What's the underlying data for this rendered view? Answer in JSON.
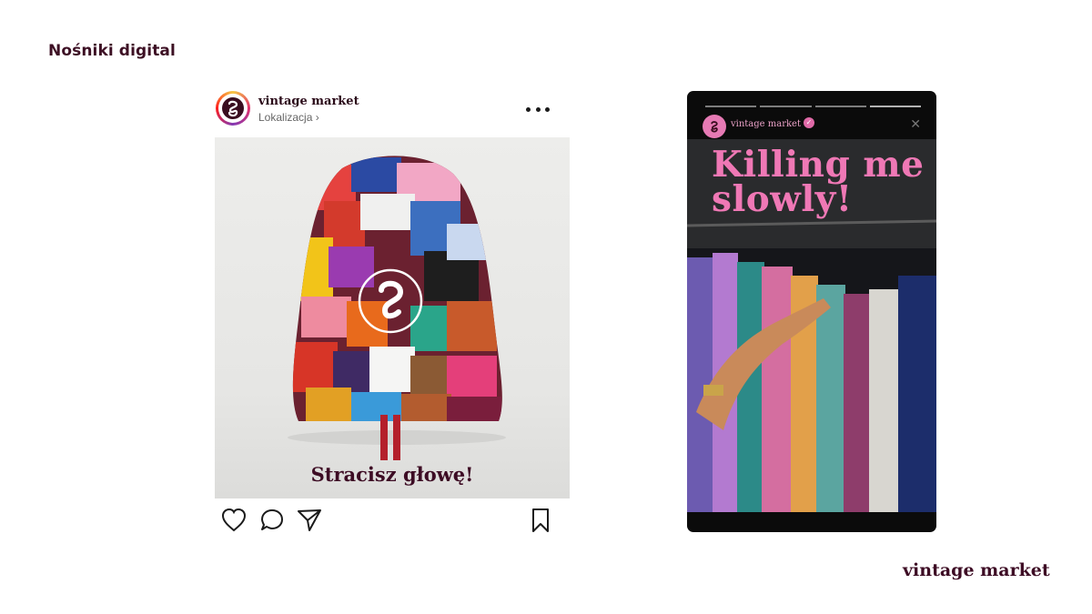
{
  "page": {
    "heading": "Nośniki digital",
    "brand_footer": "vintage market"
  },
  "post": {
    "username": "vintage market",
    "location": "Lokalizacja ›",
    "caption": "Stracisz głowę!",
    "actions": [
      "heart-icon",
      "comment-icon",
      "share-icon",
      "bookmark-icon"
    ]
  },
  "story": {
    "username": "vintage market",
    "headline": "Killing me slowly!",
    "close": "✕"
  },
  "colors": {
    "brand": "#3d0c24",
    "accent_pink": "#ef78b5",
    "story_bg": "#0b0b0b"
  }
}
